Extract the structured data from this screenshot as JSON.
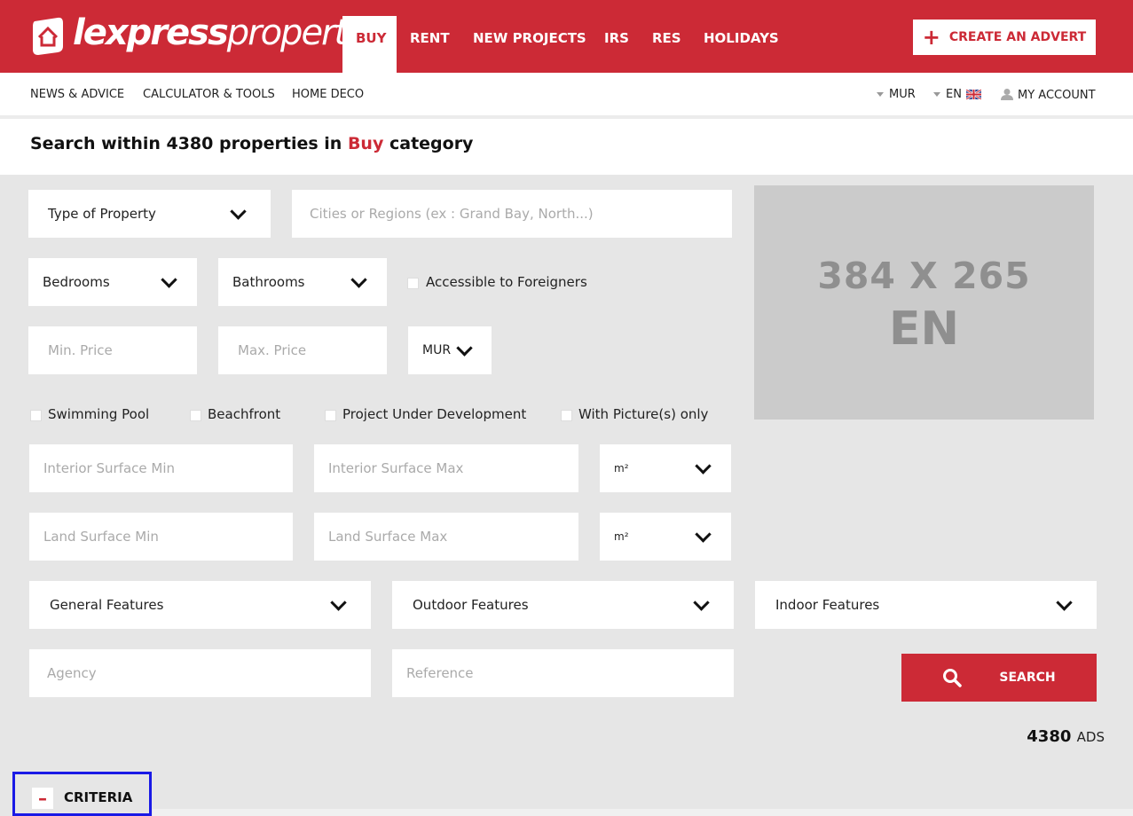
{
  "header": {
    "logo_bold": "lexpress",
    "logo_light": "property",
    "nav": [
      "BUY",
      "RENT",
      "NEW PROJECTS",
      "IRS",
      "RES",
      "HOLIDAYS"
    ],
    "create_advert": "CREATE AN ADVERT",
    "accent_color": "#cc2a36"
  },
  "subnav": {
    "links": [
      "NEWS & ADVICE",
      "CALCULATOR & TOOLS",
      "HOME DECO"
    ],
    "currency": "MUR",
    "language": "EN",
    "account": "MY ACCOUNT"
  },
  "title": {
    "prefix": "Search within 4380 properties in",
    "category": "Buy",
    "suffix": "category"
  },
  "form": {
    "type_of_property": "Type of Property",
    "cities_placeholder": "Cities or Regions (ex : Grand Bay, North...)",
    "bedrooms": "Bedrooms",
    "bathrooms": "Bathrooms",
    "accessible_foreigners": "Accessible to Foreigners",
    "min_price_placeholder": "Min. Price",
    "max_price_placeholder": "Max. Price",
    "currency_select": "MUR",
    "checkbox_swimming_pool": "Swimming Pool",
    "checkbox_beachfront": "Beachfront",
    "checkbox_project": "Project Under Development",
    "checkbox_pictures": "With Picture(s) only",
    "interior_min": "Interior Surface Min",
    "interior_max": "Interior Surface Max",
    "unit1": "m²",
    "land_min": "Land Surface Min",
    "land_max": "Land Surface Max",
    "unit2": "m²",
    "general_features": "General Features",
    "outdoor_features": "Outdoor Features",
    "indoor_features": "Indoor Features",
    "agency_placeholder": "Agency",
    "reference_placeholder": "Reference",
    "search_button": "SEARCH"
  },
  "ad": {
    "line1": "384 X 265",
    "line2": "EN"
  },
  "results": {
    "count": "4380",
    "label": "ADS"
  },
  "criteria": {
    "toggle_symbol": "–",
    "label": "CRITERIA"
  }
}
